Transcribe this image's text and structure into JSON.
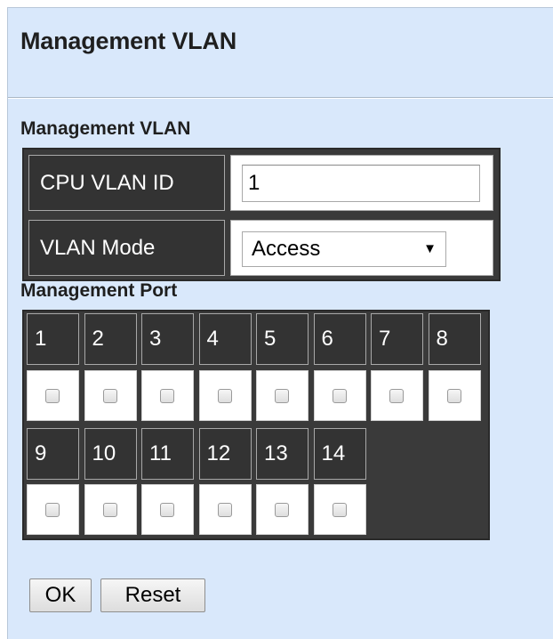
{
  "page": {
    "title": "Management VLAN"
  },
  "vlan_section": {
    "title": "Management VLAN",
    "cpu_vlan_id_label": "CPU VLAN ID",
    "cpu_vlan_id_value": "1",
    "vlan_mode_label": "VLAN Mode",
    "vlan_mode_value": "Access"
  },
  "port_section": {
    "title": "Management Port",
    "ports": [
      "1",
      "2",
      "3",
      "4",
      "5",
      "6",
      "7",
      "8",
      "9",
      "10",
      "11",
      "12",
      "13",
      "14"
    ],
    "checked": [
      false,
      false,
      false,
      false,
      false,
      false,
      false,
      false,
      false,
      false,
      false,
      false,
      false,
      false
    ]
  },
  "buttons": {
    "ok": "OK",
    "reset": "Reset"
  },
  "colors": {
    "panel_background": "#d9e8fb",
    "table_header_background": "#333333"
  },
  "icons": {
    "select_arrow": "dropdown-triangle-icon"
  }
}
